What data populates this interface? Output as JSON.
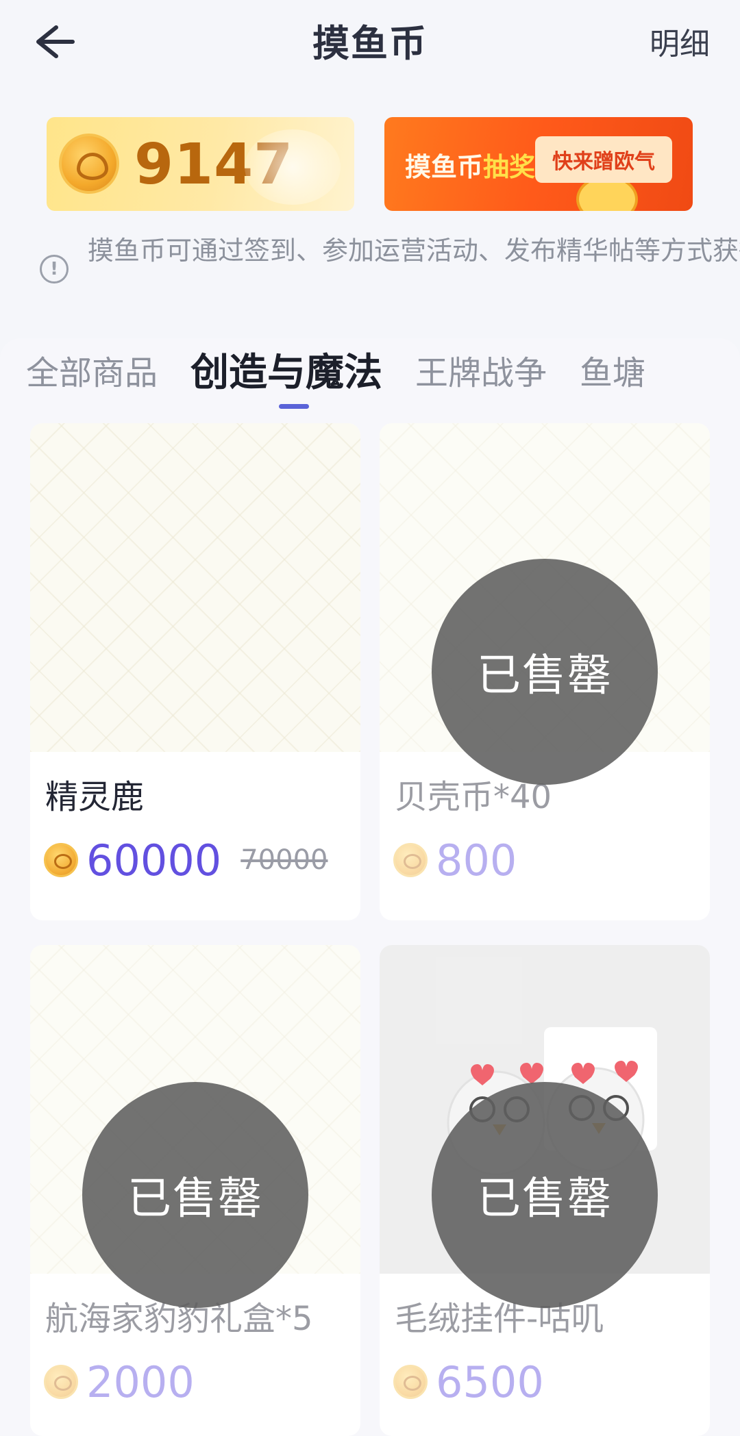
{
  "header": {
    "title": "摸鱼币",
    "detail_label": "明细"
  },
  "balance": {
    "value": "9147"
  },
  "lottery": {
    "text_prefix": "摸鱼币",
    "text_highlight": "抽奖",
    "badge": "快来蹭欧气"
  },
  "notice": {
    "icon": "info-icon",
    "text": "摸鱼币可通过签到、参加运营活动、发布精华帖等方式获得"
  },
  "tabs": [
    {
      "label": "全部商品",
      "active": false
    },
    {
      "label": "创造与魔法",
      "active": true
    },
    {
      "label": "王牌战争",
      "active": false
    },
    {
      "label": "鱼塘",
      "active": false
    }
  ],
  "products": [
    {
      "name": "精灵鹿",
      "price": "60000",
      "original_price": "70000",
      "sold_out": false
    },
    {
      "name": "贝壳币*40",
      "price": "800",
      "sold_out": true,
      "sold_label": "已售罄"
    },
    {
      "name": "航海家豹豹礼盒*5",
      "price": "2000",
      "sold_out": true,
      "sold_label": "已售罄"
    },
    {
      "name": "毛绒挂件-咕叽",
      "price": "6500",
      "sold_out": true,
      "sold_label": "已售罄"
    }
  ],
  "colors": {
    "accent": "#5a63d8",
    "price": "#6250e0",
    "coin": "#f3ad35"
  }
}
